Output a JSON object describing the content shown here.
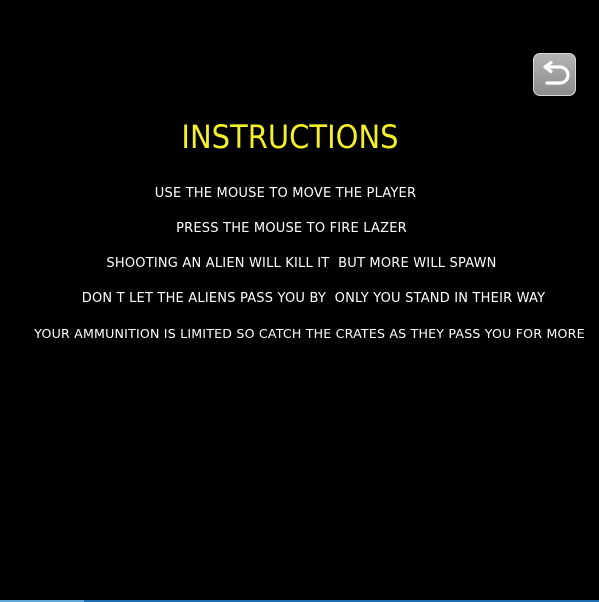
{
  "screen": {
    "title": "INSTRUCTIONS",
    "lines": [
      "USE THE MOUSE TO MOVE THE PLAYER",
      "PRESS THE MOUSE TO FIRE LAZER",
      "SHOOTING AN ALIEN WILL KILL IT  BUT MORE WILL SPAWN",
      "DON T LET THE ALIENS PASS YOU BY  ONLY YOU STAND IN THEIR WAY",
      "YOUR AMMUNITION IS LIMITED SO CATCH THE CRATES AS THEY PASS YOU FOR MORE"
    ],
    "back_icon": "undo-arrow-icon"
  },
  "colors": {
    "background": "#000000",
    "title": "#f3ef2a",
    "text": "#ffffff",
    "button": "#9e9e9e"
  }
}
